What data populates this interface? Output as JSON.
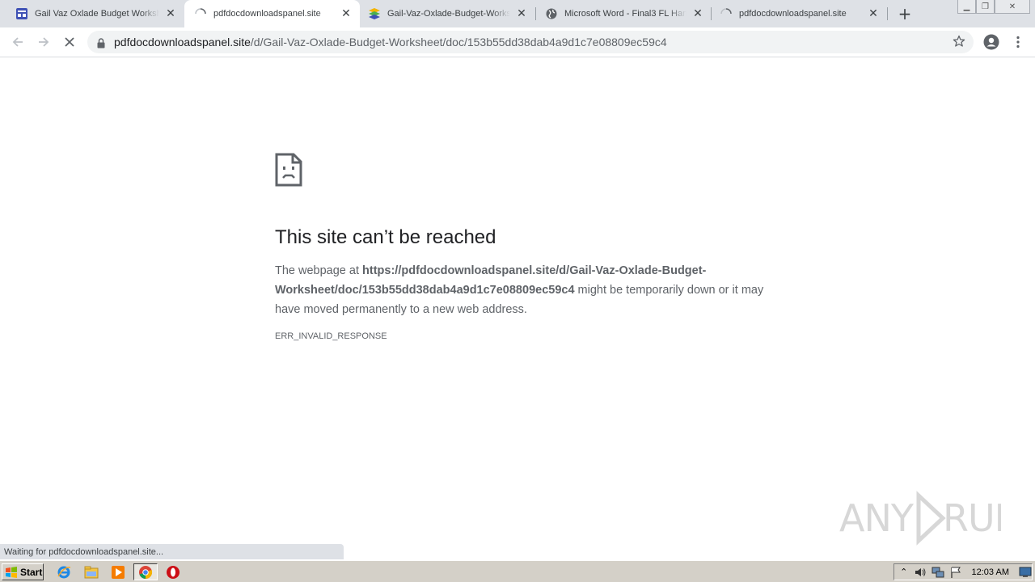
{
  "browser": {
    "tabs": [
      {
        "title": "Gail Vaz Oxlade Budget Worksheet",
        "icon": "forms-icon",
        "active": false,
        "loading": false
      },
      {
        "title": "pdfdocdownloadspanel.site",
        "icon": "loading-spinner-icon",
        "active": true,
        "loading": true
      },
      {
        "title": "Gail-Vaz-Oxlade-Budget-Worksheet",
        "icon": "stack-icon",
        "active": false,
        "loading": false
      },
      {
        "title": "Microsoft Word - Final3 FL Handout",
        "icon": "globe-icon",
        "active": false,
        "loading": false
      },
      {
        "title": "pdfdocdownloadspanel.site",
        "icon": "loading-spinner-icon",
        "active": false,
        "loading": true
      }
    ],
    "new_tab_symbol": "+",
    "address": {
      "host": "pdfdocdownloadspanel.site",
      "path": "/d/Gail-Vaz-Oxlade-Budget-Worksheet/doc/153b55dd38dab4a9d1c7e08809ec59c4"
    }
  },
  "error_page": {
    "title": "This site can’t be reached",
    "desc_prefix": "The webpage at ",
    "desc_url": "https://pdfdocdownloadspanel.site/d/Gail-Vaz-Oxlade-Budget-Worksheet/doc/153b55dd38dab4a9d1c7e08809ec59c4",
    "desc_suffix": " might be temporarily down or it may have moved permanently to a new web address.",
    "error_code": "ERR_INVALID_RESPONSE"
  },
  "status_bar": "Waiting for pdfdocdownloadspanel.site...",
  "watermark": "ANY RUN",
  "taskbar": {
    "start_label": "Start",
    "clock": "12:03 AM"
  },
  "colors": {
    "tabstrip": "#dee1e6",
    "omnibox": "#f1f3f4",
    "taskbar": "#d4d0c8",
    "title_text": "#202124",
    "body_text": "#5f6368"
  }
}
